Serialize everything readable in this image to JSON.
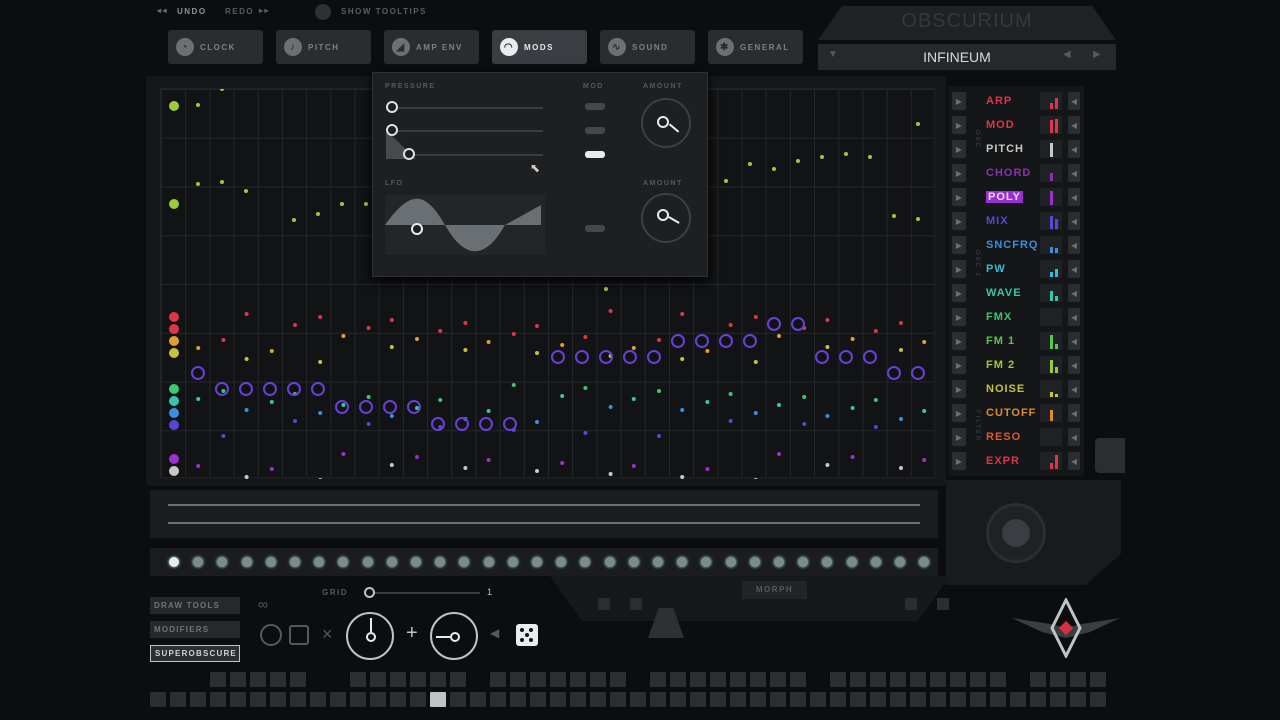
{
  "topbar": {
    "undo": "UNDO",
    "redo": "REDO",
    "tooltips": "SHOW TOOLTIPS"
  },
  "tabs": [
    {
      "label": "CLOCK",
      "icon": "clock-icon",
      "active": false
    },
    {
      "label": "PITCH",
      "icon": "pitch-icon",
      "active": false
    },
    {
      "label": "AMP ENV",
      "icon": "envelope-icon",
      "active": false
    },
    {
      "label": "MODS",
      "icon": "mods-icon",
      "active": true
    },
    {
      "label": "SOUND",
      "icon": "sound-icon",
      "active": false
    },
    {
      "label": "GENERAL",
      "icon": "gear-icon",
      "active": false
    }
  ],
  "header": {
    "logo": "OBSCURIUM",
    "preset": "INFINEUM"
  },
  "mod_popup": {
    "section1": "PRESSURE",
    "mod_label": "MOD",
    "amount1": "AMOUNT",
    "section2": "LFO",
    "amount2": "AMOUNT"
  },
  "modulators": [
    {
      "label": "ARP",
      "color": "#e0344a"
    },
    {
      "label": "MOD",
      "color": "#e0344a"
    },
    {
      "label": "PITCH",
      "color": "#c8c8c8"
    },
    {
      "label": "CHORD",
      "color": "#8b2fb5"
    },
    {
      "label": "POLY",
      "color": "#9b30d0"
    },
    {
      "label": "MIX",
      "color": "#5a45d8"
    },
    {
      "label": "SNCFRQ",
      "color": "#3a8fe0"
    },
    {
      "label": "PW",
      "color": "#39b8d8"
    },
    {
      "label": "WAVE",
      "color": "#35c7a8"
    },
    {
      "label": "FMX",
      "color": "#3ac870"
    },
    {
      "label": "FM 1",
      "color": "#58c84a"
    },
    {
      "label": "FM 2",
      "color": "#9acb3a"
    },
    {
      "label": "NOISE",
      "color": "#c8c23a"
    },
    {
      "label": "CUTOFF",
      "color": "#e08a30"
    },
    {
      "label": "RESO",
      "color": "#e05830"
    },
    {
      "label": "EXPR",
      "color": "#e0344a"
    }
  ],
  "side_groups": {
    "g1": "OSC",
    "g2": "OSC 2",
    "g3": "FILTER"
  },
  "bottom": {
    "draw_tools": "DRAW TOOLS",
    "modifiers": "MODIFIERS",
    "superobscure": "SUPEROBSCURE",
    "grid_label": "GRID",
    "grid_value": "1",
    "morph": "MORPH"
  },
  "colors": {
    "accent": "#e9ecef",
    "poly": "#9b30d0"
  }
}
